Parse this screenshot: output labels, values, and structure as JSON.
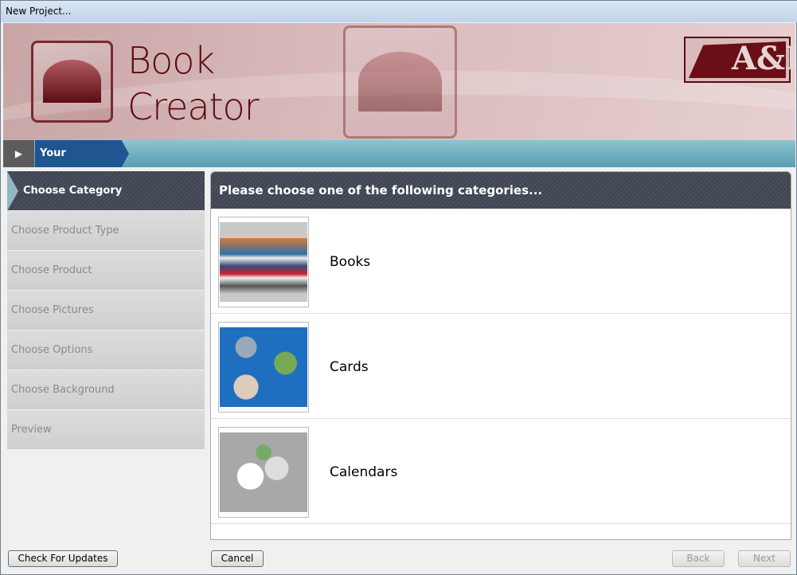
{
  "window": {
    "title": "New Project..."
  },
  "banner": {
    "brand_line1": "Book",
    "brand_line2": "Creator",
    "company_logo": "A&I"
  },
  "selections": {
    "label": "Your Selections:"
  },
  "sidebar": {
    "items": [
      {
        "label": "Choose Category",
        "active": true
      },
      {
        "label": "Choose Product Type",
        "active": false
      },
      {
        "label": "Choose Product",
        "active": false
      },
      {
        "label": "Choose Pictures",
        "active": false
      },
      {
        "label": "Choose Options",
        "active": false
      },
      {
        "label": "Choose Background",
        "active": false
      },
      {
        "label": "Preview",
        "active": false
      }
    ]
  },
  "main": {
    "heading": "Please choose one of the following categories...",
    "categories": [
      {
        "label": "Books"
      },
      {
        "label": "Cards"
      },
      {
        "label": "Calendars"
      }
    ]
  },
  "buttons": {
    "check_updates": "Check For Updates",
    "cancel": "Cancel",
    "back": "Back",
    "next": "Next"
  }
}
